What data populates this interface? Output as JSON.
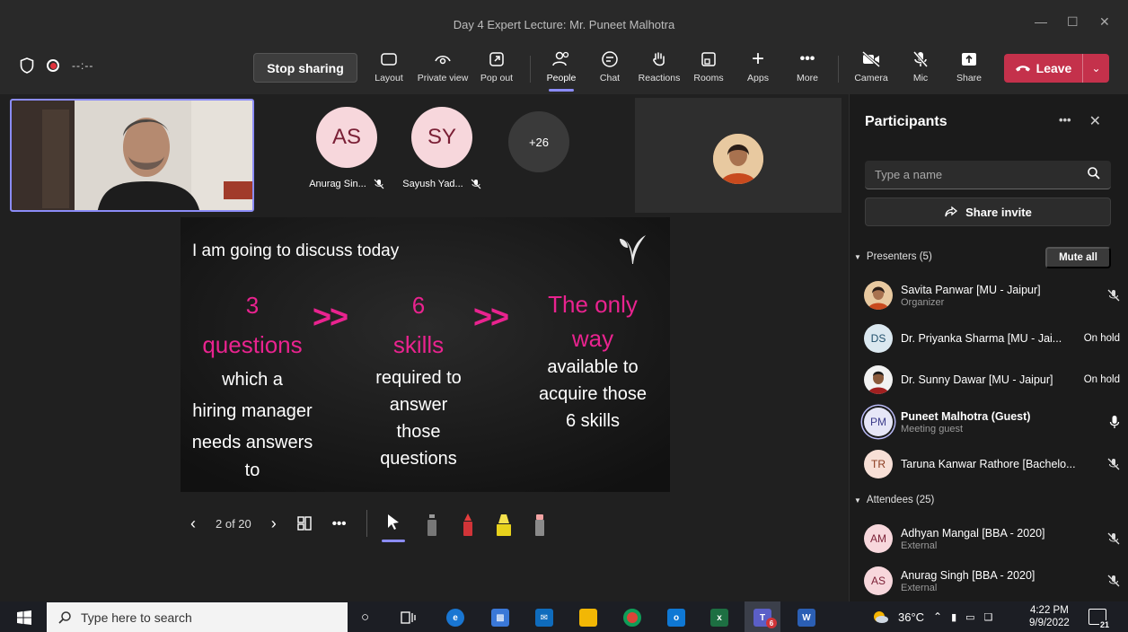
{
  "window": {
    "title": "Day 4 Expert Lecture: Mr. Puneet Malhotra"
  },
  "toolbar": {
    "timer": "--:--",
    "stop_sharing": "Stop sharing",
    "buttons": [
      {
        "label": "Layout",
        "icon": "layout-icon"
      },
      {
        "label": "Private view",
        "icon": "eye-icon"
      },
      {
        "label": "Pop out",
        "icon": "popout-icon"
      },
      {
        "label": "People",
        "icon": "people-icon",
        "active": true
      },
      {
        "label": "Chat",
        "icon": "chat-icon"
      },
      {
        "label": "Reactions",
        "icon": "hand-icon"
      },
      {
        "label": "Rooms",
        "icon": "rooms-icon"
      },
      {
        "label": "Apps",
        "icon": "plus-icon"
      },
      {
        "label": "More",
        "icon": "more-icon"
      },
      {
        "label": "Camera",
        "icon": "camera-off-icon"
      },
      {
        "label": "Mic",
        "icon": "mic-off-icon"
      },
      {
        "label": "Share",
        "icon": "share-icon"
      }
    ],
    "leave": "Leave"
  },
  "stage": {
    "tiles": [
      {
        "initials": "AS",
        "name": "Anurag Sin...",
        "bg": "#f7d7dc",
        "fg": "#7a1f35"
      },
      {
        "initials": "SY",
        "name": "Sayush Yad...",
        "bg": "#f7d7dc",
        "fg": "#7a1f35"
      }
    ],
    "more_count": "+26"
  },
  "slide": {
    "intro": "I am going to discuss today",
    "col1": {
      "pink": [
        "3",
        "questions"
      ],
      "white": [
        "which a",
        "hiring manager",
        "needs answers",
        "to"
      ]
    },
    "col2": {
      "pink": [
        "6",
        "skills"
      ],
      "white": [
        "required to",
        "answer",
        "those",
        "questions"
      ]
    },
    "col3": {
      "pink": [
        "The only",
        "way"
      ],
      "white": [
        "available to",
        "acquire those",
        "6 skills"
      ]
    },
    "arrow": ">>",
    "page": "2 of 20"
  },
  "participants": {
    "title": "Participants",
    "search_placeholder": "Type a name",
    "share_invite": "Share invite",
    "presenters_header": "Presenters (5)",
    "mute_all": "Mute all",
    "presenters": [
      {
        "name": "Savita Panwar [MU - Jaipur]",
        "sub": "Organizer",
        "avatar": "photo",
        "status": "",
        "mic": "mic-off-icon"
      },
      {
        "name": "Dr. Priyanka Sharma [MU - Jai...",
        "sub": "",
        "avatar": "DS",
        "bg": "#dbe8f0",
        "fg": "#1f4e6a",
        "status": "On hold",
        "mic": ""
      },
      {
        "name": "Dr. Sunny Dawar [MU - Jaipur]",
        "sub": "",
        "avatar": "photo2",
        "status": "On hold",
        "mic": ""
      },
      {
        "name": "Puneet Malhotra (Guest)",
        "sub": "Meeting guest",
        "avatar": "PM",
        "bg": "#e6e6f7",
        "fg": "#3b3b8a",
        "status": "",
        "mic": "mic-on-icon",
        "bold": true
      },
      {
        "name": "Taruna Kanwar Rathore [Bachelo...",
        "sub": "",
        "avatar": "TR",
        "bg": "#f7dfd6",
        "fg": "#8a3b1f",
        "status": "",
        "mic": "mic-off-icon"
      }
    ],
    "attendees_header": "Attendees (25)",
    "attendees": [
      {
        "name": "Adhyan Mangal [BBA - 2020]",
        "sub": "External",
        "avatar": "AM",
        "bg": "#f7d7dc",
        "fg": "#7a1f35",
        "mic": "mic-off-icon"
      },
      {
        "name": "Anurag Singh [BBA - 2020]",
        "sub": "External",
        "avatar": "AS",
        "bg": "#f7d7dc",
        "fg": "#7a1f35",
        "mic": "mic-off-icon"
      }
    ]
  },
  "taskbar": {
    "search_placeholder": "Type here to search",
    "temperature": "36°C",
    "time": "4:22 PM",
    "date": "9/9/2022",
    "teams_badge": "6",
    "notif_count": "21"
  },
  "colors": {
    "accent": "#8b8cf7",
    "leave": "#c4314b",
    "slide_pink": "#e9238f"
  }
}
